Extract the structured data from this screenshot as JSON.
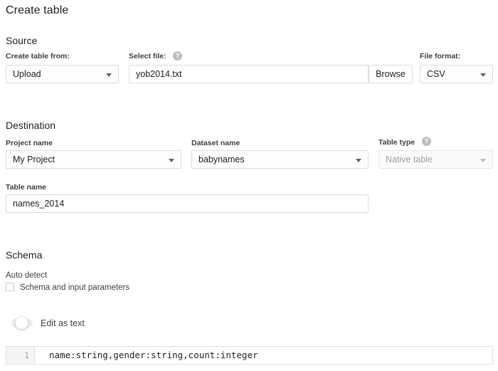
{
  "page": {
    "title": "Create table"
  },
  "source": {
    "heading": "Source",
    "create_table_from": {
      "label": "Create table from:",
      "value": "Upload"
    },
    "select_file": {
      "label": "Select file:",
      "value": "yob2014.txt",
      "help_icon": "help-circle-icon",
      "help_glyph": "?",
      "browse_label": "Browse"
    },
    "file_format": {
      "label": "File format:",
      "value": "CSV"
    }
  },
  "destination": {
    "heading": "Destination",
    "project_name": {
      "label": "Project name",
      "value": "My Project"
    },
    "dataset_name": {
      "label": "Dataset name",
      "value": "babynames"
    },
    "table_type": {
      "label": "Table type",
      "value": "Native table",
      "help_icon": "help-circle-icon",
      "help_glyph": "?",
      "disabled": true
    },
    "table_name": {
      "label": "Table name",
      "value": "names_2014"
    }
  },
  "schema": {
    "heading": "Schema",
    "auto_detect": {
      "label": "Auto detect",
      "checkbox_label": "Schema and input parameters",
      "checked": false
    },
    "edit_as_text": {
      "label": "Edit as text",
      "enabled": false
    },
    "editor": {
      "line_number": "1",
      "line_text": "name:string,gender:string,count:integer"
    }
  },
  "colors": {
    "text": "#212121",
    "label": "#3c4043",
    "border": "#dadce0",
    "disabled_text": "#9aa0a6",
    "gutter_bg": "#f5f5f5"
  }
}
